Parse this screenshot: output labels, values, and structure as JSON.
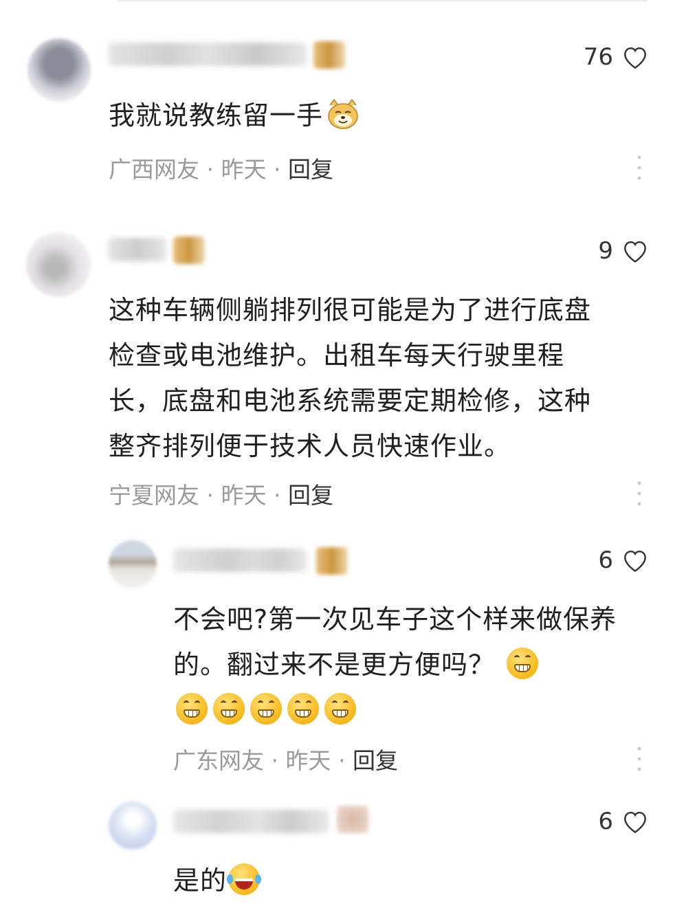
{
  "comments": [
    {
      "likes": "76",
      "text": "我就说教练留一手",
      "emoji_suffix": "doge-emoji",
      "meta": {
        "location": "广西网友",
        "sep1": " · ",
        "time": "昨天",
        "sep2": " · ",
        "reply": "回复"
      }
    },
    {
      "likes": "9",
      "text": "这种车辆侧躺排列很可能是为了进行底盘检查或电池维护。出租车每天行驶里程长，底盘和电池系统需要定期检修，这种整齐排列便于技术人员快速作业。",
      "meta": {
        "location": "宁夏网友",
        "sep1": " · ",
        "time": "昨天",
        "sep2": " · ",
        "reply": "回复"
      }
    },
    {
      "likes": "6",
      "text": "不会吧?第一次见车子这个样来做保养的。翻过来不是更方便吗？",
      "emoji_suffix": "grin-emoji x6",
      "meta": {
        "location": "广东网友",
        "sep1": " · ",
        "time": "昨天",
        "sep2": " · ",
        "reply": "回复"
      }
    },
    {
      "likes": "6",
      "text": "是的",
      "emoji_suffix": "laugh-tears-emoji"
    }
  ],
  "colors": {
    "meta_gray": "#9a9a9a",
    "text": "#1f1f1f",
    "heart_stroke": "#333333"
  }
}
